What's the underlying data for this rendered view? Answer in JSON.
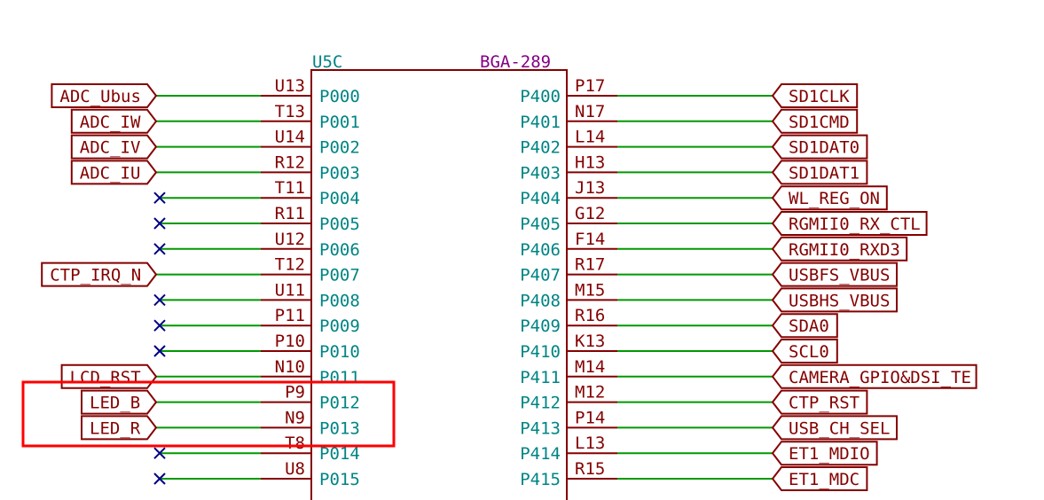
{
  "component": {
    "reference": "U5C",
    "package": "BGA-289"
  },
  "colors": {
    "wire": "#009900",
    "body": "#840000",
    "pin_name": "#008484",
    "label": "#840000",
    "no_connect": "#000084",
    "highlight": "#ff0000"
  },
  "left_pins": [
    {
      "ball": "U13",
      "name": "P000",
      "net": "ADC_Ubus",
      "no_connect": false
    },
    {
      "ball": "T13",
      "name": "P001",
      "net": "ADC_IW",
      "no_connect": false
    },
    {
      "ball": "U14",
      "name": "P002",
      "net": "ADC_IV",
      "no_connect": false
    },
    {
      "ball": "R12",
      "name": "P003",
      "net": "ADC_IU",
      "no_connect": false
    },
    {
      "ball": "T11",
      "name": "P004",
      "net": "",
      "no_connect": true
    },
    {
      "ball": "R11",
      "name": "P005",
      "net": "",
      "no_connect": true
    },
    {
      "ball": "U12",
      "name": "P006",
      "net": "",
      "no_connect": true
    },
    {
      "ball": "T12",
      "name": "P007",
      "net": "CTP_IRQ_N",
      "no_connect": false
    },
    {
      "ball": "U11",
      "name": "P008",
      "net": "",
      "no_connect": true
    },
    {
      "ball": "P11",
      "name": "P009",
      "net": "",
      "no_connect": true
    },
    {
      "ball": "P10",
      "name": "P010",
      "net": "",
      "no_connect": true
    },
    {
      "ball": "N10",
      "name": "P011",
      "net": "LCD_RST",
      "no_connect": false
    },
    {
      "ball": "P9",
      "name": "P012",
      "net": "LED_B",
      "no_connect": false
    },
    {
      "ball": "N9",
      "name": "P013",
      "net": "LED_R",
      "no_connect": false
    },
    {
      "ball": "T8",
      "name": "P014",
      "net": "",
      "no_connect": true
    },
    {
      "ball": "U8",
      "name": "P015",
      "net": "",
      "no_connect": true
    }
  ],
  "right_pins": [
    {
      "ball": "P17",
      "name": "P400",
      "net": "SD1CLK"
    },
    {
      "ball": "N17",
      "name": "P401",
      "net": "SD1CMD"
    },
    {
      "ball": "L14",
      "name": "P402",
      "net": "SD1DAT0"
    },
    {
      "ball": "H13",
      "name": "P403",
      "net": "SD1DAT1"
    },
    {
      "ball": "J13",
      "name": "P404",
      "net": "WL_REG_ON"
    },
    {
      "ball": "G12",
      "name": "P405",
      "net": "RGMII0_RX_CTL"
    },
    {
      "ball": "F14",
      "name": "P406",
      "net": "RGMII0_RXD3"
    },
    {
      "ball": "R17",
      "name": "P407",
      "net": "USBFS_VBUS"
    },
    {
      "ball": "M15",
      "name": "P408",
      "net": "USBHS_VBUS"
    },
    {
      "ball": "R16",
      "name": "P409",
      "net": "SDA0"
    },
    {
      "ball": "K13",
      "name": "P410",
      "net": "SCL0"
    },
    {
      "ball": "M14",
      "name": "P411",
      "net": "CAMERA_GPIO&DSI_TE"
    },
    {
      "ball": "M12",
      "name": "P412",
      "net": "CTP_RST"
    },
    {
      "ball": "P14",
      "name": "P413",
      "net": "USB_CH_SEL"
    },
    {
      "ball": "L13",
      "name": "P414",
      "net": "ET1_MDIO"
    },
    {
      "ball": "R15",
      "name": "P415",
      "net": "ET1_MDC"
    }
  ],
  "highlighted_pins": [
    "P012",
    "P013"
  ]
}
